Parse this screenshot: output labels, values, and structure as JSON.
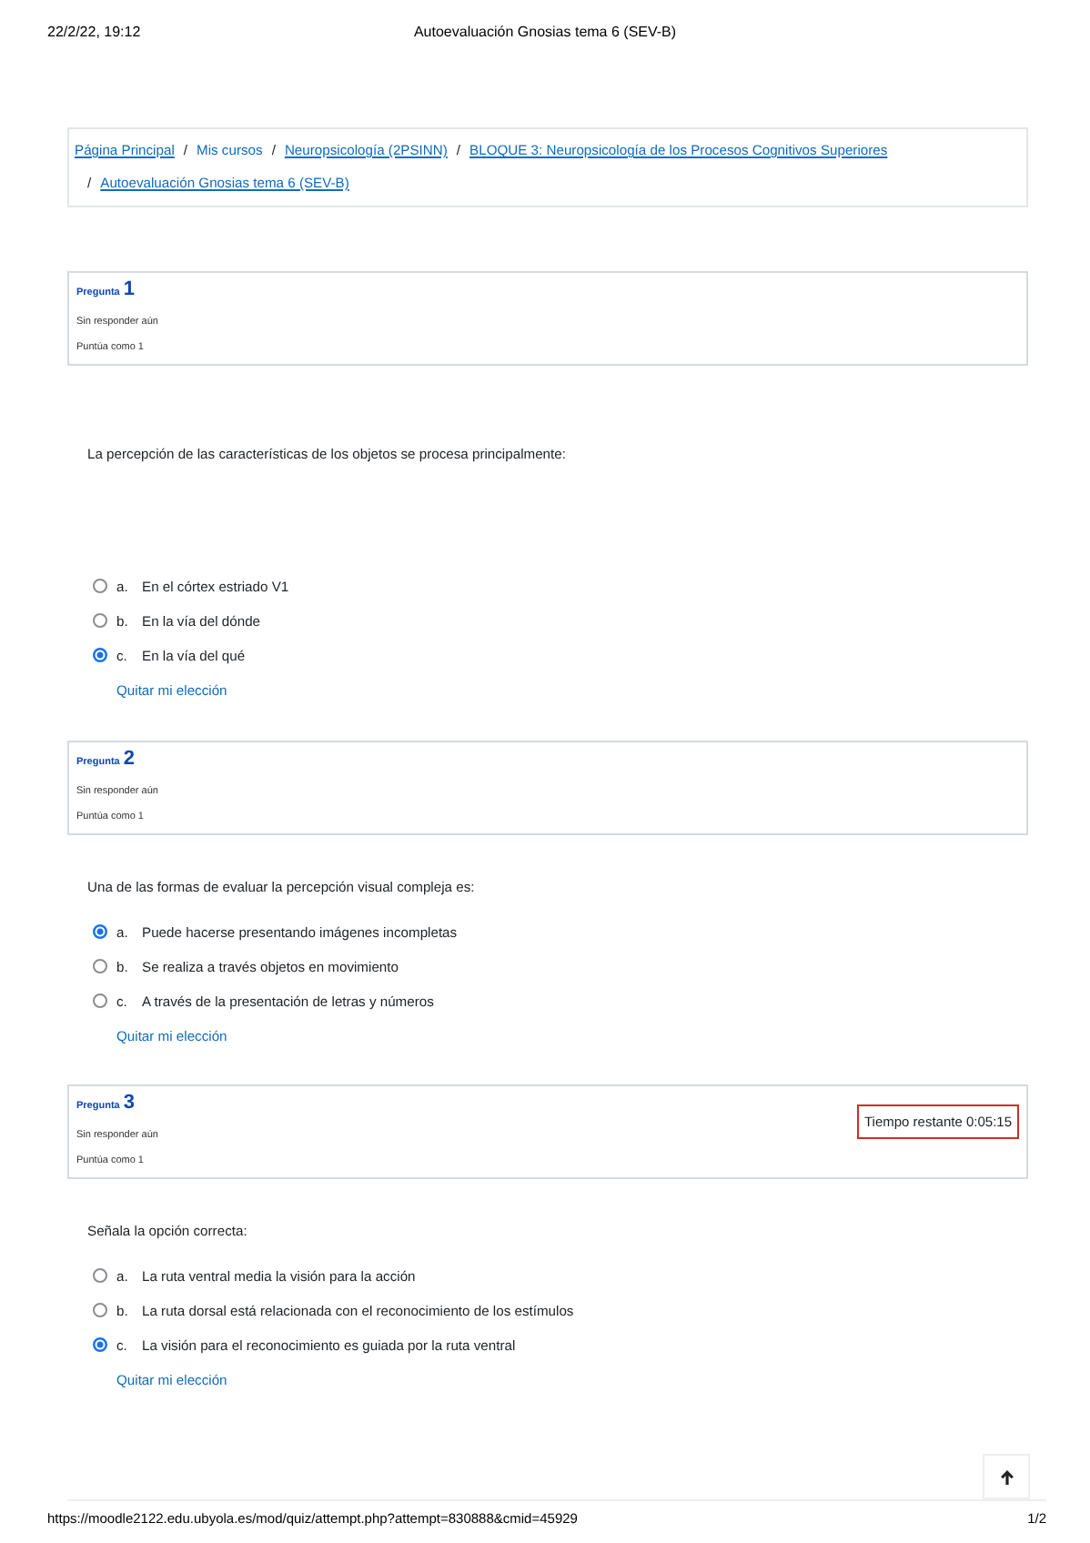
{
  "print_header": {
    "date": "22/2/22, 19:12",
    "title": "Autoevaluación Gnosias tema 6 (SEV-B)"
  },
  "breadcrumb": {
    "separator": "/",
    "items": [
      {
        "label": "Página Principal",
        "kind": "link"
      },
      {
        "label": "Mis cursos",
        "kind": "text"
      },
      {
        "label": "Neuropsicología (2PSINN)",
        "kind": "link"
      },
      {
        "label": "BLOQUE 3: Neuropsicología de los Procesos Cognitivos Superiores",
        "kind": "link"
      },
      {
        "label": "Autoevaluación Gnosias tema 6 (SEV-B)",
        "kind": "link"
      }
    ]
  },
  "questions": [
    {
      "label": "Pregunta",
      "number": "1",
      "status": "Sin responder aún",
      "marks": "Puntúa como 1",
      "text": "La percepción de las características de los objetos se procesa principalmente:",
      "options": [
        {
          "letter": "a.",
          "text": "En el córtex estriado V1",
          "selected": false
        },
        {
          "letter": "b.",
          "text": "En la vía del dónde",
          "selected": false
        },
        {
          "letter": "c.",
          "text": "En la vía del qué",
          "selected": true
        }
      ],
      "clear_link": "Quitar mi elección"
    },
    {
      "label": "Pregunta",
      "number": "2",
      "status": "Sin responder aún",
      "marks": "Puntúa como 1",
      "text": "Una de las formas de evaluar la percepción visual compleja es:",
      "options": [
        {
          "letter": "a.",
          "text": "Puede hacerse presentando imágenes incompletas",
          "selected": true
        },
        {
          "letter": "b.",
          "text": "Se realiza a través objetos en movimiento",
          "selected": false
        },
        {
          "letter": "c.",
          "text": "A través de la presentación de letras y números",
          "selected": false
        }
      ],
      "clear_link": "Quitar mi elección"
    },
    {
      "label": "Pregunta",
      "number": "3",
      "status": "Sin responder aún",
      "marks": "Puntúa como 1",
      "timer": "Tiempo restante 0:05:15",
      "text": "Señala la opción correcta:",
      "options": [
        {
          "letter": "a.",
          "text": "La ruta ventral media la visión para la acción",
          "selected": false
        },
        {
          "letter": "b.",
          "text": "La ruta dorsal está relacionada con el reconocimiento de los estímulos",
          "selected": false
        },
        {
          "letter": "c.",
          "text": "La visión para el reconocimiento es guiada por la ruta ventral",
          "selected": true
        }
      ],
      "clear_link": "Quitar mi elección"
    }
  ],
  "print_footer": {
    "url": "https://moodle2122.edu.ubyola.es/mod/quiz/attempt.php?attempt=830888&cmid=45929",
    "page": "1/2"
  }
}
